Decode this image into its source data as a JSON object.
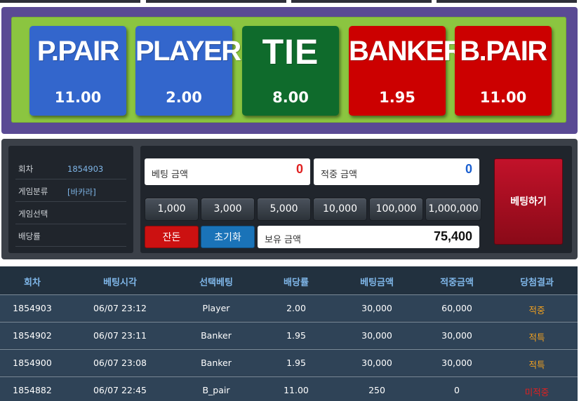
{
  "bet_options": [
    {
      "name": "P.PAIR",
      "odds": "11.00",
      "color": "#3366cc"
    },
    {
      "name": "PLAYER",
      "odds": "2.00",
      "color": "#3366cc"
    },
    {
      "name": "TIE",
      "odds": "8.00",
      "color": "#0f6b2c"
    },
    {
      "name": "BANKER",
      "odds": "1.95",
      "color": "#cc0000"
    },
    {
      "name": "B.PAIR",
      "odds": "11.00",
      "color": "#cc0000"
    }
  ],
  "info": {
    "round_label": "회차",
    "round_value": "1854903",
    "category_label": "게임분류",
    "category_value": "[바카라]",
    "selection_label": "게임선택",
    "selection_value": "",
    "odds_label": "배당률",
    "odds_value": ""
  },
  "bet": {
    "amount_label": "베팅 금액",
    "amount_value": "0",
    "win_label": "적중 금액",
    "win_value": "0",
    "balance_label": "보유 금액",
    "balance_value": "75,400",
    "place_label": "베팅하기",
    "change_label": "잔돈",
    "reset_label": "초기화"
  },
  "chips": [
    "1,000",
    "3,000",
    "5,000",
    "10,000",
    "100,000",
    "1,000,000"
  ],
  "history": {
    "headers": [
      "회차",
      "베팅시각",
      "선택베팅",
      "배당률",
      "베팅금액",
      "적중금액",
      "당첨결과"
    ],
    "rows": [
      {
        "round": "1854903",
        "time": "06/07 23:12",
        "choice": "Player",
        "odds": "2.00",
        "bet": "30,000",
        "win": "60,000",
        "result": "적중",
        "result_color": "#f0a020"
      },
      {
        "round": "1854902",
        "time": "06/07 23:11",
        "choice": "Banker",
        "odds": "1.95",
        "bet": "30,000",
        "win": "30,000",
        "result": "적특",
        "result_color": "#f0a020"
      },
      {
        "round": "1854900",
        "time": "06/07 23:08",
        "choice": "Banker",
        "odds": "1.95",
        "bet": "30,000",
        "win": "30,000",
        "result": "적특",
        "result_color": "#f0a020"
      },
      {
        "round": "1854882",
        "time": "06/07 22:45",
        "choice": "B_pair",
        "odds": "11.00",
        "bet": "250",
        "win": "0",
        "result": "미적중",
        "result_color": "#e02020"
      }
    ]
  }
}
